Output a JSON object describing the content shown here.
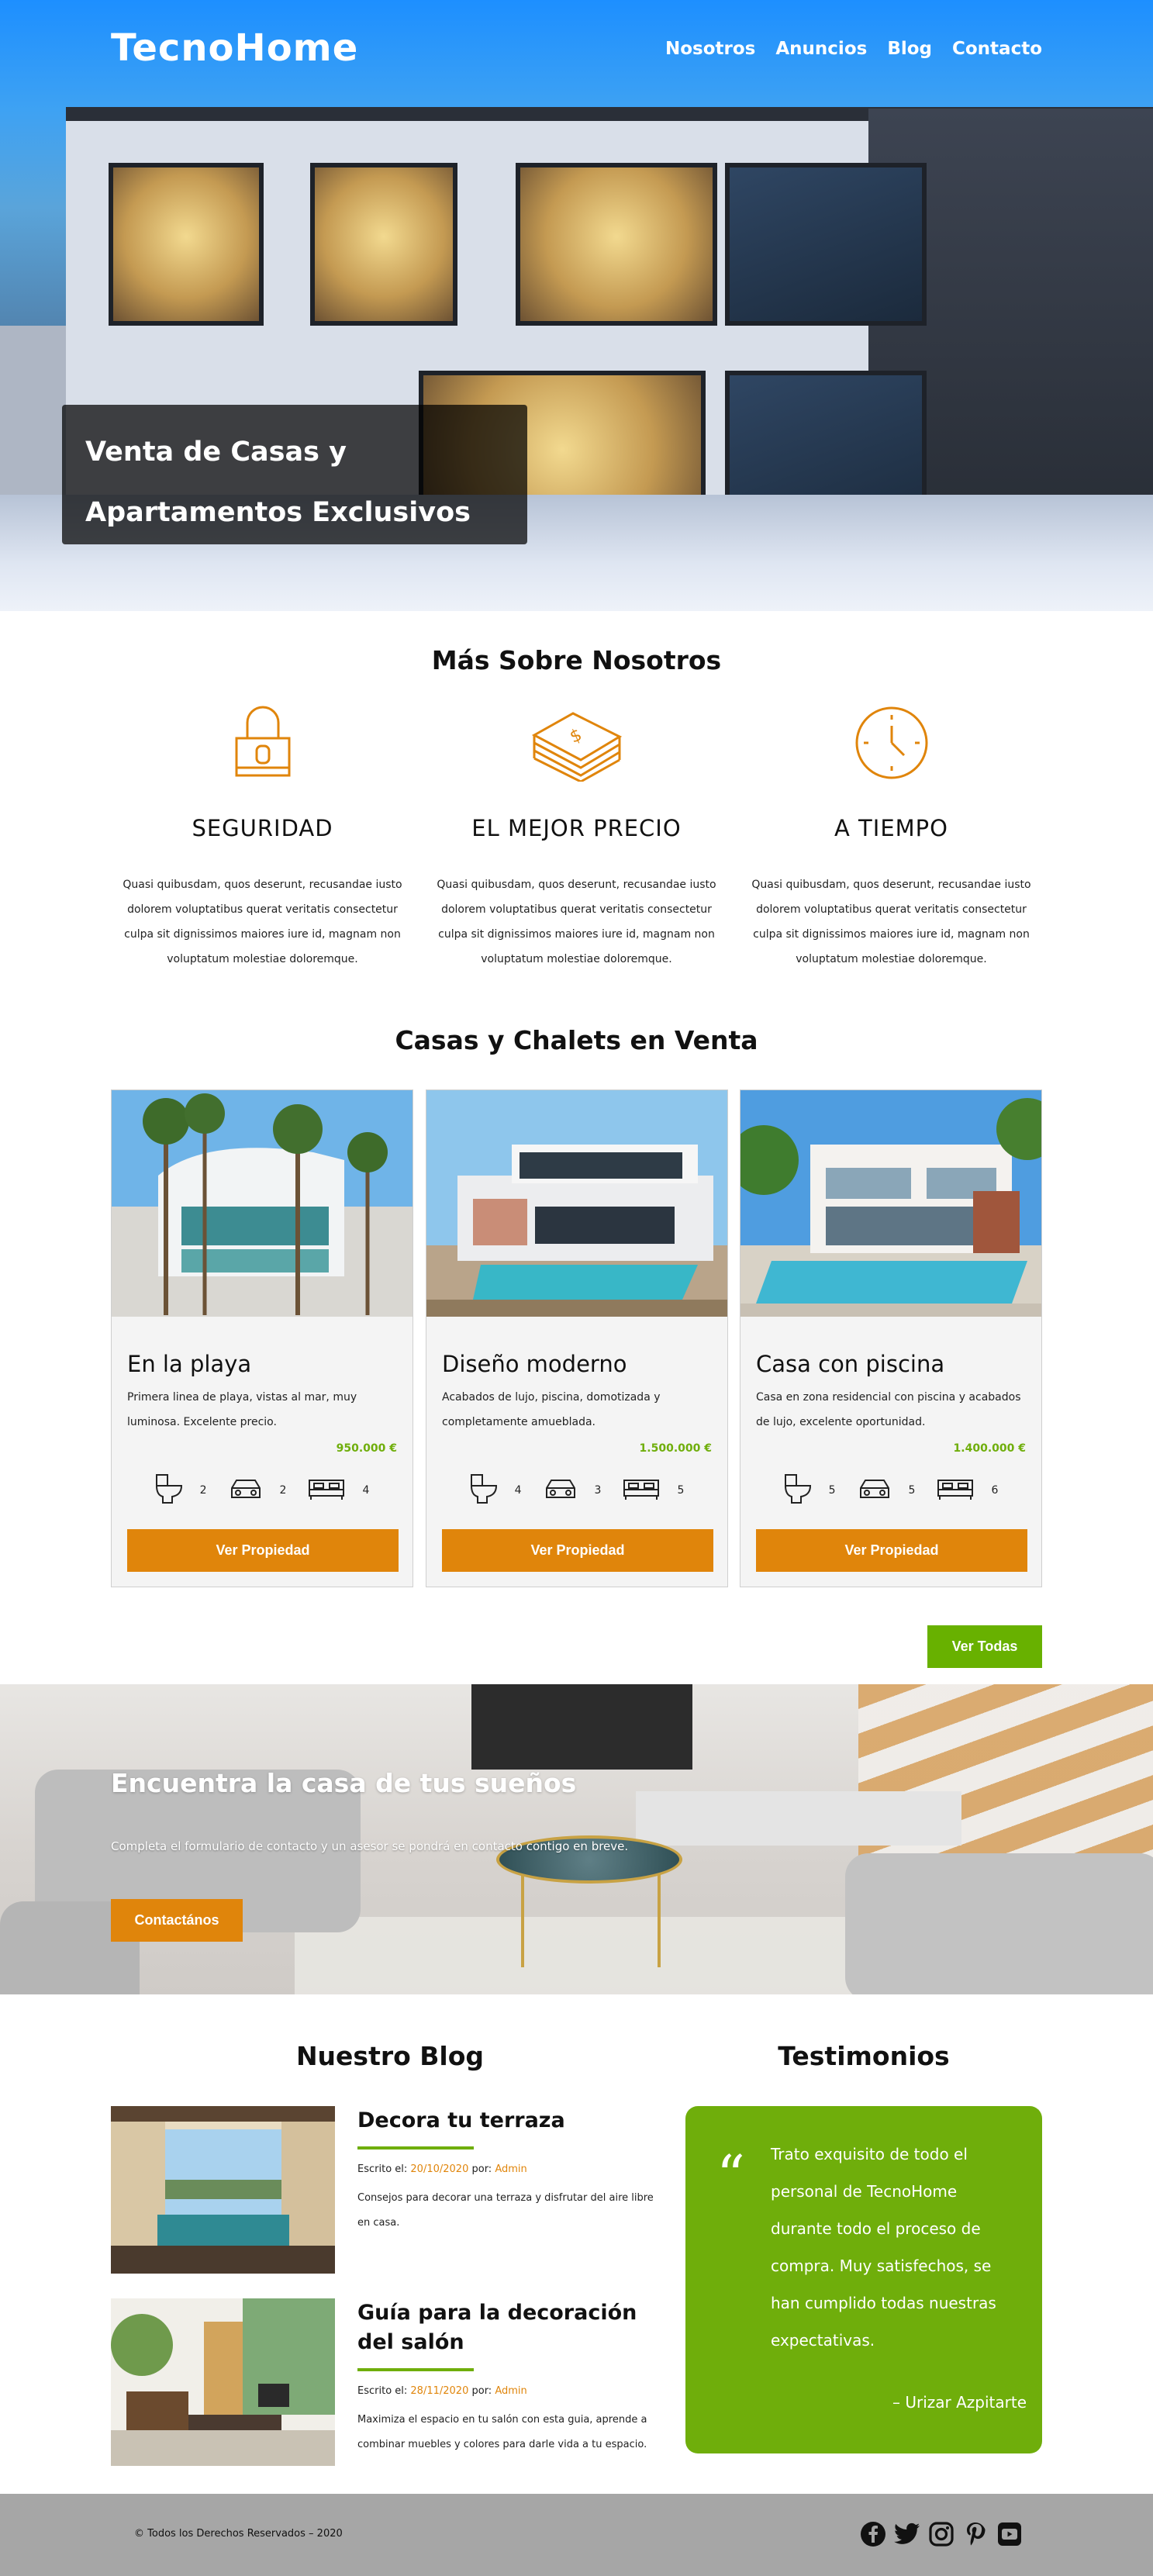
{
  "header": {
    "logo": "TecnoHome",
    "nav": [
      "Nosotros",
      "Anuncios",
      "Blog",
      "Contacto"
    ],
    "hero_line1": "Venta de Casas y",
    "hero_line2": "Apartamentos Exclusivos"
  },
  "about": {
    "title": "Más Sobre Nosotros",
    "features": [
      {
        "icon": "lock-icon",
        "title": "SEGURIDAD",
        "text": "Quasi quibusdam, quos deserunt, recusandae iusto dolorem voluptatibus querat veritatis consectetur culpa sit dignissimos maiores iure id, magnam non voluptatum molestiae doloremque."
      },
      {
        "icon": "money-stack-icon",
        "title": "EL MEJOR PRECIO",
        "text": "Quasi quibusdam, quos deserunt, recusandae iusto dolorem voluptatibus querat veritatis consectetur culpa sit dignissimos maiores iure id, magnam non voluptatum molestiae doloremque."
      },
      {
        "icon": "clock-icon",
        "title": "A TIEMPO",
        "text": "Quasi quibusdam, quos deserunt, recusandae iusto dolorem voluptatibus querat veritatis consectetur culpa sit dignissimos maiores iure id, magnam non voluptatum molestiae doloremque."
      }
    ]
  },
  "listings": {
    "title": "Casas y Chalets en Venta",
    "items": [
      {
        "title": "En la playa",
        "desc": "Primera linea de playa, vistas al mar, muy luminosa. Excelente precio.",
        "price": "950.000 €",
        "wc": "2",
        "parking": "2",
        "rooms": "4",
        "button": "Ver Propiedad"
      },
      {
        "title": "Diseño moderno",
        "desc": "Acabados de lujo, piscina, domotizada y completamente amueblada.",
        "price": "1.500.000 €",
        "wc": "4",
        "parking": "3",
        "rooms": "5",
        "button": "Ver Propiedad"
      },
      {
        "title": "Casa con piscina",
        "desc": "Casa en zona residencial con piscina y acabados de lujo, excelente oportunidad.",
        "price": "1.400.000 €",
        "wc": "5",
        "parking": "5",
        "rooms": "6",
        "button": "Ver Propiedad"
      }
    ],
    "view_all": "Ver Todas"
  },
  "cta": {
    "title": "Encuentra la casa de tus sueños",
    "text": "Completa el formulario de contacto y un asesor se pondrá en contacto contigo en breve.",
    "button": "Contactános"
  },
  "blog": {
    "title": "Nuestro Blog",
    "posts": [
      {
        "title": "Decora tu terraza",
        "meta_label": "Escrito el:",
        "date": "20/10/2020",
        "by": "por:",
        "author": "Admin",
        "excerpt": "Consejos para decorar una terraza y disfrutar del aire libre en casa."
      },
      {
        "title": "Guía para la decoración del salón",
        "meta_label": "Escrito el:",
        "date": "28/11/2020",
        "by": "por:",
        "author": "Admin",
        "excerpt": "Maximiza el espacio en tu salón con esta guia, aprende a combinar muebles y colores para darle vida a tu espacio."
      }
    ]
  },
  "testimonials": {
    "title": "Testimonios",
    "quote_mark": "“",
    "text": "Trato exquisito de todo el personal de TecnoHome durante todo el proceso de compra. Muy satisfechos, se han cumplido todas nuestras expectativas.",
    "author": "– Urizar Azpitarte"
  },
  "footer": {
    "copyright": "© Todos los Derechos Reservados – 2020",
    "social": [
      "facebook-icon",
      "twitter-icon",
      "instagram-icon",
      "pinterest-icon",
      "youtube-icon"
    ]
  },
  "colors": {
    "orange": "#e0850b",
    "green": "#6fae0b",
    "footer": "#a6a6a6"
  }
}
